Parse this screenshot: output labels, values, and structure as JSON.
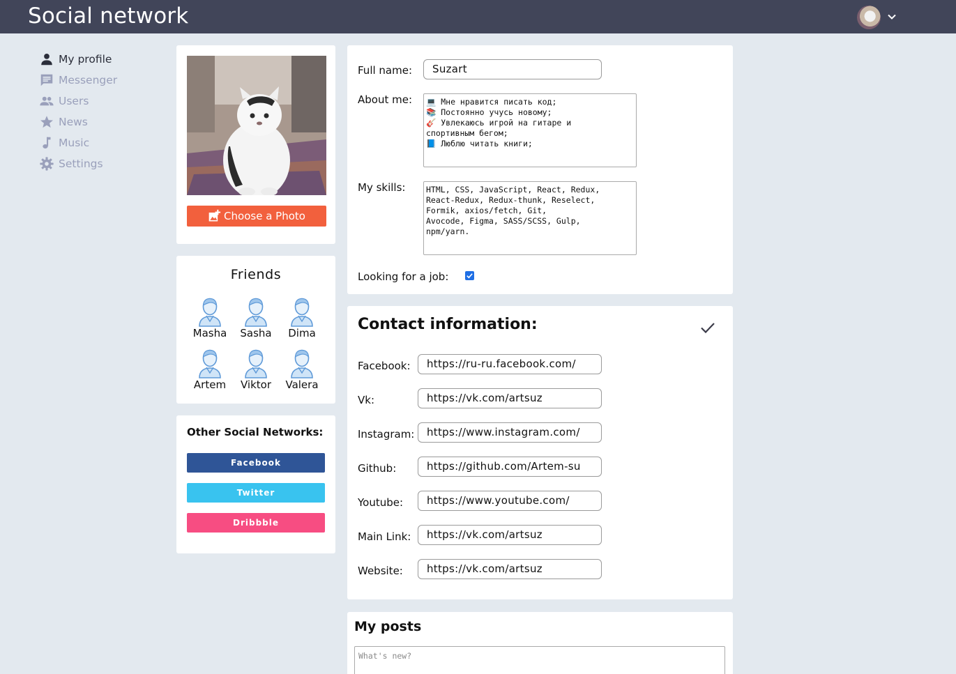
{
  "header": {
    "title": "Social network"
  },
  "sidebar": {
    "items": [
      {
        "label": "My profile",
        "icon": "person-icon"
      },
      {
        "label": "Messenger",
        "icon": "message-icon"
      },
      {
        "label": "Users",
        "icon": "users-icon"
      },
      {
        "label": "News",
        "icon": "star-icon"
      },
      {
        "label": "Music",
        "icon": "music-note-icon"
      },
      {
        "label": "Settings",
        "icon": "gear-icon"
      }
    ]
  },
  "photo": {
    "choose_label": "Choose a Photo"
  },
  "friends": {
    "title": "Friends",
    "items": [
      {
        "name": "Masha"
      },
      {
        "name": "Sasha"
      },
      {
        "name": "Dima"
      },
      {
        "name": "Artem"
      },
      {
        "name": "Viktor"
      },
      {
        "name": "Valera"
      }
    ]
  },
  "social": {
    "title": "Other Social Networks:",
    "buttons": [
      {
        "label": "Facebook",
        "color": "#2f5597"
      },
      {
        "label": "Twitter",
        "color": "#39c3ef"
      },
      {
        "label": "Dribbble",
        "color": "#f74d82"
      }
    ]
  },
  "profile_form": {
    "full_name_label": "Full name:",
    "full_name_value": "Suzart",
    "about_label": "About me:",
    "about_lines": [
      "💻 Мне нравится писать код;",
      "📚 Постоянно учусь новому;",
      "🎸 Увлекаюсь игрой на гитаре и",
      "спортивным бегом;",
      "📘 Люблю читать книги;"
    ],
    "skills_label": "My skills:",
    "skills_lines": [
      "HTML, CSS, JavaScript, React, Redux,",
      "React-Redux, Redux-thunk, Reselect,",
      "Formik, axios/fetch, Git,",
      "Avocode, Figma, SASS/SCSS, Gulp,",
      "npm/yarn."
    ],
    "job_label": "Looking for a job:",
    "job_checked": true
  },
  "contacts": {
    "title": "Contact information:",
    "fields": [
      {
        "label": "Facebook:",
        "value": "https://ru-ru.facebook.com/"
      },
      {
        "label": "Vk:",
        "value": "https://vk.com/artsuz"
      },
      {
        "label": "Instagram:",
        "value": "https://www.instagram.com/"
      },
      {
        "label": "Github:",
        "value": "https://github.com/Artem-su"
      },
      {
        "label": "Youtube:",
        "value": "https://www.youtube.com/"
      },
      {
        "label": "Main Link:",
        "value": "https://vk.com/artsuz"
      },
      {
        "label": "Website:",
        "value": "https://vk.com/artsuz"
      }
    ]
  },
  "posts": {
    "title": "My posts",
    "placeholder": "What's new?"
  },
  "colors": {
    "header_bg": "#414559",
    "accent": "#f2603d",
    "checkbox": "#1f6fe5",
    "nav_inactive": "#9aa0bb"
  }
}
